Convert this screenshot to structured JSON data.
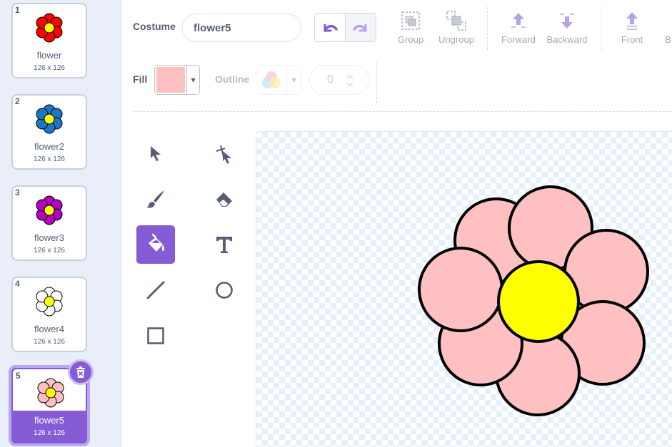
{
  "costumes": [
    {
      "number": "1",
      "name": "flower",
      "size": "126 x 126",
      "petal_color": "#ff0000",
      "selected": false
    },
    {
      "number": "2",
      "name": "flower2",
      "size": "126 x 126",
      "petal_color": "#1a78c6",
      "selected": false
    },
    {
      "number": "3",
      "name": "flower3",
      "size": "126 x 126",
      "petal_color": "#b400c0",
      "selected": false
    },
    {
      "number": "4",
      "name": "flower4",
      "size": "126 x 126",
      "petal_color": "#ffffff",
      "selected": false
    },
    {
      "number": "5",
      "name": "flower5",
      "size": "126 x 126",
      "petal_color": "#ffc0c2",
      "selected": true
    }
  ],
  "toolbar": {
    "costume_label": "Costume",
    "costume_name": "flower5",
    "group_label": "Group",
    "ungroup_label": "Ungroup",
    "forward_label": "Forward",
    "backward_label": "Backward",
    "front_label": "Front",
    "back_label": "B"
  },
  "fill": {
    "label": "Fill",
    "color": "#ffc0c2",
    "caret": "▾"
  },
  "outline": {
    "label": "Outline",
    "caret": "▾",
    "width": "0"
  },
  "tools": [
    {
      "name": "select",
      "active": false
    },
    {
      "name": "reshape",
      "active": false
    },
    {
      "name": "brush",
      "active": false
    },
    {
      "name": "eraser",
      "active": false
    },
    {
      "name": "fill",
      "active": true
    },
    {
      "name": "text",
      "active": false
    },
    {
      "name": "line",
      "active": false
    },
    {
      "name": "circle",
      "active": false
    },
    {
      "name": "rectangle",
      "active": false
    }
  ],
  "colors": {
    "accent": "#855cd6",
    "text": "#575e75",
    "petal": "#ffc0c2",
    "center": "#ffff00",
    "outline": "#000000"
  }
}
